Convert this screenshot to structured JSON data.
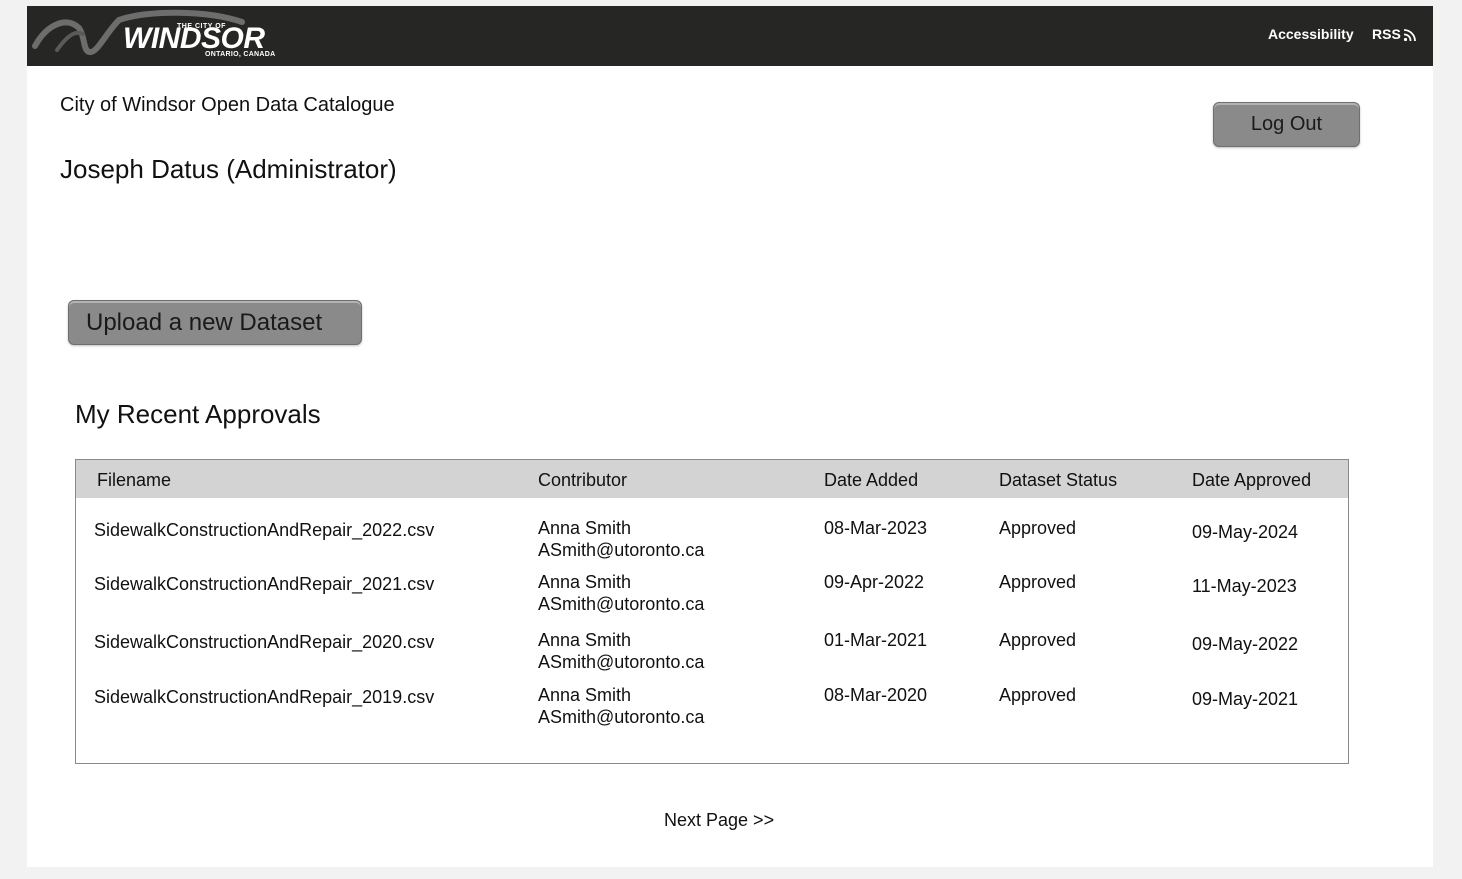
{
  "header": {
    "logo": {
      "line1": "THE CITY OF",
      "line2": "WINDSOR",
      "line3": "ONTARIO, CANADA"
    },
    "accessibility_link": "Accessibility",
    "rss_link": "RSS",
    "rss_icon": "rss-feed-icon"
  },
  "page": {
    "catalog_title": "City of Windsor Open Data Catalogue",
    "user_name": "Joseph Datus (Administrator)",
    "logout_label": "Log Out",
    "upload_label": "Upload a new Dataset",
    "section_title": "My Recent Approvals",
    "next_page_label": "Next Page >>"
  },
  "table": {
    "headers": [
      "Filename",
      "Contributor",
      "Date Added",
      "Dataset Status",
      "Date Approved"
    ],
    "rows": [
      {
        "filename": "SidewalkConstructionAndRepair_2022.csv",
        "contributor_name": "Anna Smith",
        "contributor_email": "ASmith@utoronto.ca",
        "date_added": "08-Mar-2023",
        "status": "Approved",
        "date_approved": "09-May-2024"
      },
      {
        "filename": "SidewalkConstructionAndRepair_2021.csv",
        "contributor_name": "Anna Smith",
        "contributor_email": "ASmith@utoronto.ca",
        "date_added": "09-Apr-2022",
        "status": "Approved",
        "date_approved": "11-May-2023"
      },
      {
        "filename": "SidewalkConstructionAndRepair_2020.csv",
        "contributor_name": "Anna Smith",
        "contributor_email": "ASmith@utoronto.ca",
        "date_added": "01-Mar-2021",
        "status": "Approved",
        "date_approved": "09-May-2022"
      },
      {
        "filename": "SidewalkConstructionAndRepair_2019.csv",
        "contributor_name": "Anna Smith",
        "contributor_email": "ASmith@utoronto.ca",
        "date_added": "08-Mar-2020",
        "status": "Approved",
        "date_approved": "09-May-2021"
      }
    ]
  },
  "colors": {
    "topbar": "#262624",
    "button": "#8a8a8a",
    "table_header": "#d3d3d3"
  }
}
